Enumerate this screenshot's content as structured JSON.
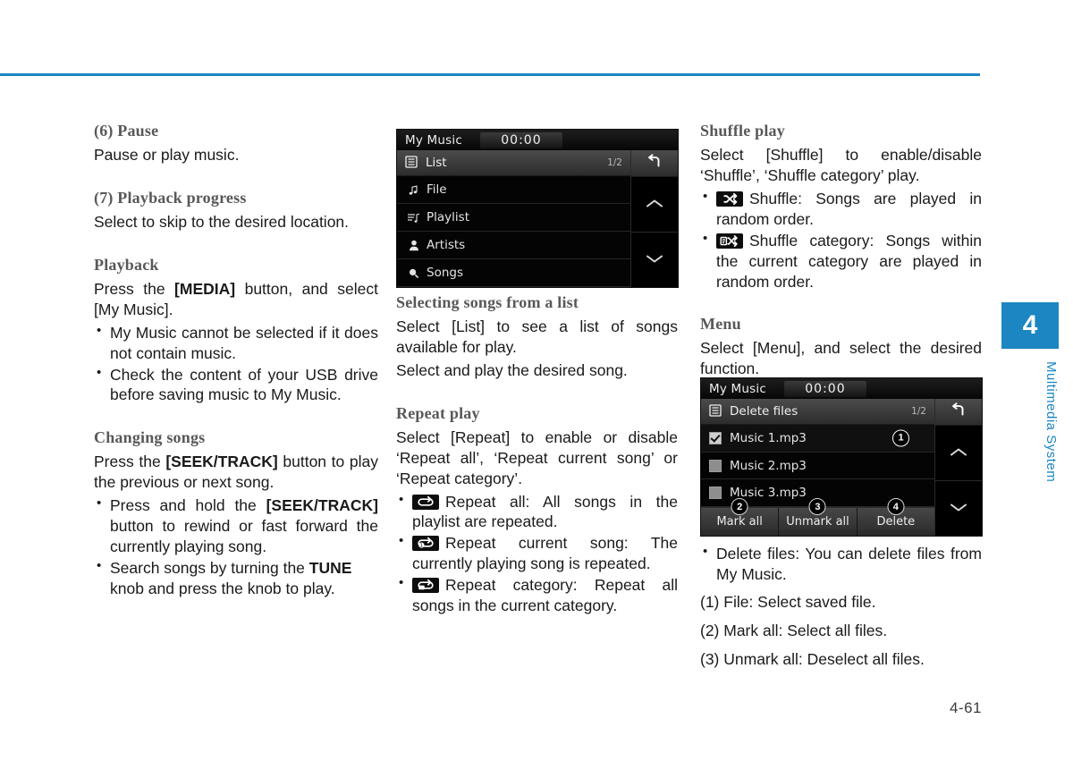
{
  "page": {
    "number": "4-61",
    "accent_color": "#1b86c2",
    "chapter_number": "4",
    "chapter_title": "Multimedia System"
  },
  "column_left": {
    "item6_heading": "(6) Pause",
    "item6_text": "Pause or play music.",
    "item7_heading": "(7) Playback progress",
    "item7_text": "Select to skip to the desired location.",
    "playback_heading": "Playback",
    "playback_text_1": "Press the ",
    "playback_bold_1": "[MEDIA]",
    "playback_text_2": " button, and select [My Music].",
    "playback_bullets": [
      "My Music cannot be selected if it does not contain music.",
      "Check the content of your USB drive before saving music to My Music."
    ],
    "changing_heading": "Changing songs",
    "changing_text_1": "Press the ",
    "changing_bold_1": "[SEEK/TRACK]",
    "changing_text_2": " button to play the previous or next song.",
    "changing_bullet1_a": "Press and hold the ",
    "changing_bullet1_b": "[SEEK/TRACK]",
    "changing_bullet1_c": " button to rewind or fast forward the currently playing song.",
    "changing_bullet2_a": "Search songs by turning the ",
    "changing_bullet2_b": "TUNE",
    "changing_bullet2_c": " knob and press the knob to play."
  },
  "screenshot_list": {
    "title": "My Music",
    "time": "00:00",
    "subheader_label": "List",
    "subheader_page": "1/2",
    "rows": [
      {
        "label": "File",
        "icon": "music-note-icon"
      },
      {
        "label": "Playlist",
        "icon": "playlist-icon"
      },
      {
        "label": "Artists",
        "icon": "person-icon"
      },
      {
        "label": "Songs",
        "icon": "search-note-icon"
      }
    ]
  },
  "column_middle": {
    "selecting_heading": "Selecting songs from a list",
    "selecting_text_1": "Select [List] to see a list of songs available for play.",
    "selecting_text_2": "Select and play the desired song.",
    "repeat_heading": "Repeat play",
    "repeat_text": "Select [Repeat] to enable or disable ‘Repeat all’, ‘Repeat current song’ or ‘Repeat category’.",
    "repeat_bullets": [
      {
        "icon": "repeat-all-icon",
        "text": "Repeat all: All songs in the playlist are repeated."
      },
      {
        "icon": "repeat-one-icon",
        "text": "Repeat current song: The currently playing song is repeated."
      },
      {
        "icon": "repeat-category-icon",
        "text": "Repeat category: Repeat all songs in the current category."
      }
    ]
  },
  "column_right": {
    "shuffle_heading": "Shuffle play",
    "shuffle_text": "Select [Shuffle] to enable/disable ‘Shuffle’, ‘Shuffle category’ play.",
    "shuffle_bullets": [
      {
        "icon": "shuffle-icon",
        "text": "Shuffle: Songs are played in random order."
      },
      {
        "icon": "shuffle-category-icon",
        "text": "Shuffle category: Songs within the current category are played in random order."
      }
    ],
    "menu_heading": "Menu",
    "menu_text": "Select [Menu], and select the desired function.",
    "delete_bullet": "Delete files: You can delete files from My Music.",
    "numbered_items": [
      "(1) File: Select saved file.",
      "(2) Mark all: Select all files.",
      "(3) Unmark all: Deselect all files."
    ]
  },
  "screenshot_delete": {
    "title": "My Music",
    "time": "00:00",
    "subheader_label": "Delete files",
    "subheader_page": "1/2",
    "rows": [
      {
        "label": "Music 1.mp3",
        "checked": true,
        "callout": "1"
      },
      {
        "label": "Music 2.mp3",
        "checked": false,
        "callout": ""
      },
      {
        "label": "Music 3.mp3",
        "checked": false,
        "callout": ""
      }
    ],
    "footer_buttons": [
      {
        "label": "Mark all",
        "callout": "2"
      },
      {
        "label": "Unmark all",
        "callout": "3"
      },
      {
        "label": "Delete",
        "callout": "4"
      }
    ]
  }
}
